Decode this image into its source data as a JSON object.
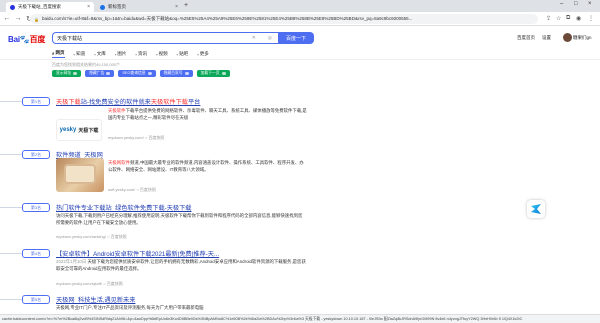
{
  "browser": {
    "tabs": [
      {
        "title": "天极下载站_百度搜索",
        "active": true
      },
      {
        "title": "新标签页",
        "active": false
      }
    ],
    "url": "baidu.com/s?ie=utf-8&f=8&rsv_bp=1&tn=baidu&wd=天极下载站&oq=%25E5%25A4%25A9%25E6%259E%2581%25E4%25B8%258B%25E8%25BD%25BD&rsv_pq=8a9c9bc6000555..."
  },
  "header": {
    "logo_text": "Bai",
    "logo_text2": "百度",
    "search_value": "天极下载站",
    "search_button": "百度一下",
    "link_homepage": "百度首页",
    "link_settings": "设置",
    "username": "糖果们gn"
  },
  "search_tabs": [
    {
      "label": "网页",
      "icon": "search-icon"
    },
    {
      "label": "知道",
      "icon": "know-icon"
    },
    {
      "label": "文库",
      "icon": "doc-icon"
    },
    {
      "label": "图片",
      "icon": "image-icon"
    },
    {
      "label": "资讯",
      "icon": "news-icon"
    },
    {
      "label": "视频",
      "icon": "video-icon"
    },
    {
      "label": "贴吧",
      "icon": "tieba-icon"
    },
    {
      "label": "更多",
      "icon": "more-icon"
    }
  ],
  "stats_text": "百度为您找到相关结果约49,100,000个",
  "filters": [
    {
      "label": "显示网址",
      "color": "#0aa858"
    },
    {
      "label": "隐藏广告",
      "color": "#4e6ef2"
    },
    {
      "label": "SEO查询信息",
      "color": "#4e6ef2"
    },
    {
      "label": "隐藏百家号",
      "color": "#4e6ef2"
    },
    {
      "label": "加载下一页",
      "color": "#0aa858"
    }
  ],
  "results": [
    {
      "rank": "第1名",
      "title_pre": "天极下载",
      "title_mid": "站-找免费安全的软件就来",
      "title_hl": "天极软件下载",
      "title_post": "平台",
      "desc_hl": "天极软件",
      "desc": "下载平台提供免费的网络软件、杀毒软件、聊天工具、系统工具、媒体播放等免费软件下载,是国内专业下载站点之一,精彩软件尽在天极",
      "src": "mydown.yesky.com/",
      "snapshot": "百度快照"
    },
    {
      "rank": "第2名",
      "title": "软件频道_天极网",
      "desc_hl": "天极网软件",
      "desc": "频道,中国最大最专业的软件频道,内容涵盖设计软件、操作系统、工具软件、程序开发、办公软件、网络安全、网站建设、IT教育等八大领域。",
      "src": "soft.yesky.com/",
      "snapshot": "百度快照"
    },
    {
      "rank": "第3名",
      "title": "热门软件专业下载站_绿色软件免费下载-天极下载",
      "desc": "访问天极下载,下载到用户已经充分理解,推荐使用说明,天极软件下载帮你下载到软件和程序代码的全部内容信息,能够快速找到您所需要的软件,让用户在下载安全放心使用。",
      "src": "mydown.yesky.com/ranking/",
      "snapshot": "百度快照"
    },
    {
      "rank": "第4名",
      "title": "【安卓软件】Android安卓软件下载2021最新|免费|推荐-天...",
      "date": "2022年1月10日",
      "desc": "天极下载为您提供优质安卓软件,让您的手机拥有无数精彩,Android安卓应用和Android软件资源的下载服务,是您获取安全可靠的Android应用软件的最佳选择。",
      "src": "mydown.yesky.com/sjsoft/",
      "snapshot": "百度快照"
    },
    {
      "rank": "第5名",
      "title": "天极网_科技生活,遇见新未来",
      "desc": "天极网,专业IT门户,专注IT产品资讯及评测服务,每天为广大用户带来最新电脑",
      "src": "",
      "snapshot": ""
    }
  ],
  "status_url": "cache.baiducontent.com/c?m=%7m%2Bca8iq2vcB%4SINSdRidq21Ah96=&p=&aoDpp%6kfEpUo6n3Ko4DtIBBeliGs%3NBpAMNo8C%1e50B%2k%6Ia2Ia%2BDAo%2bp%3r4la%3 天极下载 - yeskydown 10.10.10.187 - l0eJS9a 配ZiaZq8kJRSdnA9IjnGM99N 8v4k6 n4yvogJTfuyY2WQ 3HeH0r6b 5 1lQ4X1k2tC"
}
